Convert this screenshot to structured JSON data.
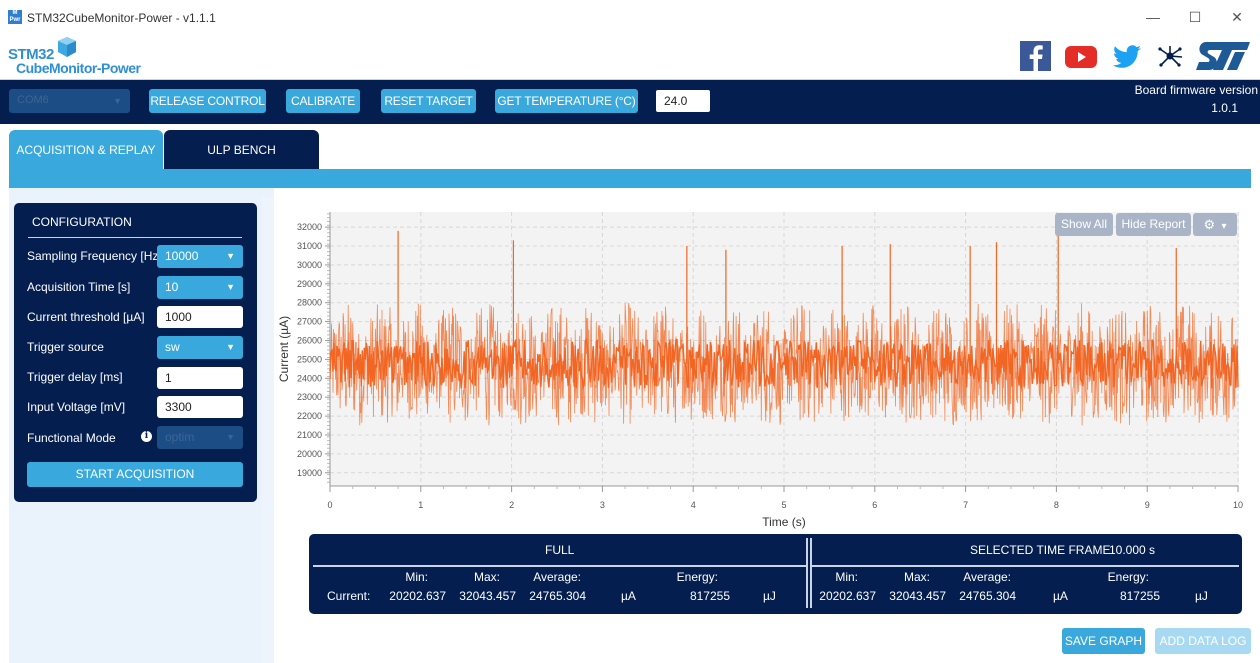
{
  "window": {
    "title": "STM32CubeMonitor-Power - v1.1.1",
    "app_icon_text": "M\nPwr",
    "minimize_glyph": "—",
    "maximize_glyph": "☐",
    "close_glyph": "✕"
  },
  "logo": {
    "line1": "STM32",
    "line2": "CubeMonitor-Power"
  },
  "social": [
    "facebook",
    "youtube",
    "twitter",
    "st-community",
    "st-logo"
  ],
  "toolbar": {
    "com_port": "COM6",
    "release_control": "RELEASE CONTROL",
    "calibrate": "CALIBRATE",
    "reset_target": "RESET TARGET",
    "get_temperature": "GET TEMPERATURE (°C)",
    "temperature_value": "24.0",
    "firmware_label": "Board firmware version",
    "firmware_version": "1.0.1"
  },
  "tabs": [
    {
      "label": "ACQUISITION & REPLAY",
      "active": true
    },
    {
      "label": "ULP BENCH",
      "active": false
    }
  ],
  "config": {
    "title": "CONFIGURATION",
    "fields": [
      {
        "label": "Sampling Frequency [Hz]",
        "type": "select",
        "value": "10000"
      },
      {
        "label": "Acquisition Time [s]",
        "type": "select",
        "value": "10"
      },
      {
        "label": "Current threshold [µA]",
        "type": "input",
        "value": "1000"
      },
      {
        "label": "Trigger source",
        "type": "select",
        "value": "sw"
      },
      {
        "label": "Trigger delay [ms]",
        "type": "input",
        "value": "1"
      },
      {
        "label": "Input Voltage [mV]",
        "type": "input",
        "value": "3300"
      },
      {
        "label": "Functional Mode",
        "type": "select-disabled",
        "value": "optim"
      }
    ],
    "start_button": "START ACQUISITION"
  },
  "chart_controls": {
    "show_all": "Show All",
    "hide_report": "Hide Report",
    "settings_caret": "▾"
  },
  "chart_data": {
    "type": "line",
    "title": "",
    "xlabel": "Time (s)",
    "ylabel": "Current (µA)",
    "xlim": [
      0,
      10
    ],
    "ylim": [
      18300,
      32800
    ],
    "x_ticks": [
      0,
      1,
      2,
      3,
      4,
      5,
      6,
      7,
      8,
      9,
      10
    ],
    "y_ticks": [
      19000,
      20000,
      21000,
      22000,
      23000,
      24000,
      25000,
      26000,
      27000,
      28000,
      29000,
      30000,
      31000,
      32000
    ],
    "grid": true,
    "color": "#f26522",
    "series": [
      {
        "name": "Current",
        "description": "Periodic bursts of roughly 0.385 s each: fast oscillation mostly between ~22000 and ~28000 µA, centered near 24765 µA, with occasional spikes up to ~32000 µA and dips to ~20200 µA",
        "burst_period_s": 0.385,
        "mean": 24765.304,
        "min": 20202.637,
        "max": 32043.457,
        "spikes": [
          {
            "x": 0.75,
            "y": 31800
          },
          {
            "x": 2.02,
            "y": 31300
          },
          {
            "x": 3.93,
            "y": 31000
          },
          {
            "x": 4.36,
            "y": 30800
          },
          {
            "x": 5.64,
            "y": 31000
          },
          {
            "x": 6.17,
            "y": 31100
          },
          {
            "x": 7.05,
            "y": 31000
          },
          {
            "x": 7.34,
            "y": 31200
          },
          {
            "x": 8.02,
            "y": 31700
          },
          {
            "x": 9.32,
            "y": 30900
          }
        ]
      }
    ]
  },
  "stats": {
    "full": {
      "title": "FULL",
      "row_label": "Current:",
      "min_label": "Min:",
      "max_label": "Max:",
      "avg_label": "Average:",
      "energy_label": "Energy:",
      "min": "20202.637",
      "max": "32043.457",
      "avg": "24765.304",
      "unit": "µA",
      "energy": "817255",
      "energy_unit": "µJ"
    },
    "selected": {
      "title": "SELECTED TIME FRAME",
      "duration": "10.000 s",
      "min_label": "Min:",
      "max_label": "Max:",
      "avg_label": "Average:",
      "energy_label": "Energy:",
      "min": "20202.637",
      "max": "32043.457",
      "avg": "24765.304",
      "unit": "µA",
      "energy": "817255",
      "energy_unit": "µJ"
    }
  },
  "bottom": {
    "save_graph": "SAVE GRAPH",
    "add_data_log": "ADD DATA LOG"
  }
}
